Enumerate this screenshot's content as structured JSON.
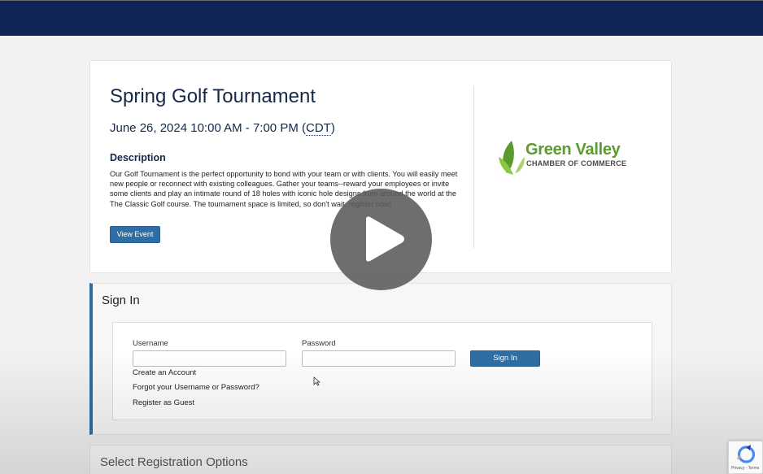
{
  "event": {
    "title": "Spring Golf Tournament",
    "date_text": "June 26, 2024 10:00 AM - 7:00 PM (",
    "timezone": "CDT",
    "date_close": ")",
    "description_heading": "Description",
    "description": "Our Golf Tournament is the perfect opportunity to bond with your team or with clients. You will easily meet new people or reconnect with existing colleagues. Gather your teams--reward your employees or invite some clients and play an intimate round of 18 holes with iconic hole designs from around the world at the The Classic Golf course. The tournament space is limited, so don't wait, register now!",
    "view_event_label": "View Event"
  },
  "logo": {
    "name": "Green Valley",
    "subtitle": "CHAMBER OF COMMERCE",
    "green": "#5a9a2f",
    "light_green": "#8cc63f"
  },
  "signin": {
    "title": "Sign In",
    "username_label": "Username",
    "password_label": "Password",
    "button_label": "Sign In",
    "links": [
      "Create an Account",
      "Forgot your Username or Password?",
      "Register as Guest"
    ]
  },
  "registration": {
    "title": "Select Registration Options"
  },
  "recaptcha": {
    "terms": "Privacy - Terms"
  },
  "colors": {
    "header": "#0e2556",
    "primary_button": "#2f6ea4",
    "heading_text": "#152849"
  }
}
